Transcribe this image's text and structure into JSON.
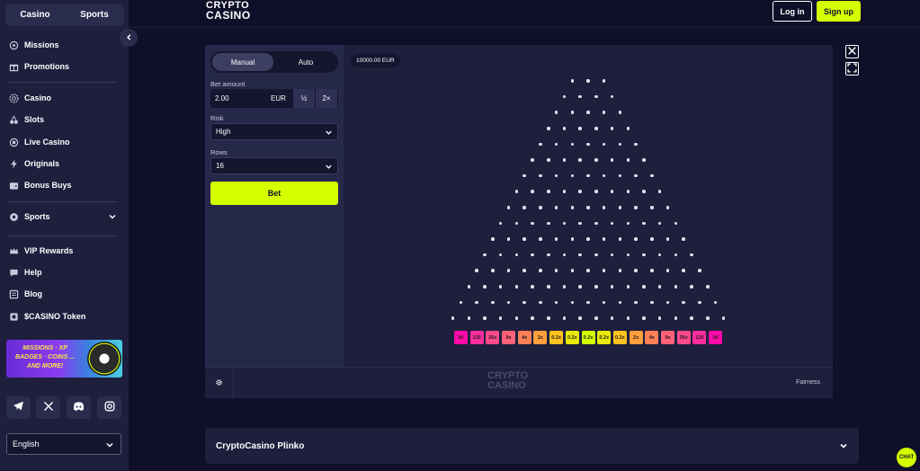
{
  "sidebar": {
    "tabs": [
      {
        "label": "Casino"
      },
      {
        "label": "Sports"
      }
    ],
    "nav": [
      {
        "label": "Missions",
        "icon": "missions-icon"
      },
      {
        "label": "Promotions",
        "icon": "gift-icon"
      },
      {
        "label": "Casino",
        "icon": "casino-chip-icon"
      },
      {
        "label": "Slots",
        "icon": "cherries-icon"
      },
      {
        "label": "Live Casino",
        "icon": "live-icon"
      },
      {
        "label": "Originals",
        "icon": "lightning-icon"
      },
      {
        "label": "Bonus Buys",
        "icon": "wallet-icon"
      },
      {
        "label": "Sports",
        "icon": "soccer-ball-icon"
      },
      {
        "label": "VIP Rewards",
        "icon": "vip-icon"
      },
      {
        "label": "Help",
        "icon": "help-icon"
      },
      {
        "label": "Blog",
        "icon": "blog-icon"
      },
      {
        "label": "$CASINO Token",
        "icon": "token-icon"
      }
    ],
    "promo": {
      "text": "MISSIONS · XP BADGES · COINS ... AND MORE!"
    },
    "socials": [
      "telegram-icon",
      "x-icon",
      "discord-icon",
      "instagram-icon"
    ],
    "language": "English"
  },
  "header": {
    "logo_line1": "CRYPTO",
    "logo_line2": "CASINO",
    "login": "Log in",
    "signup": "Sign up"
  },
  "game": {
    "modes": [
      "Manual",
      "Auto"
    ],
    "active_mode": "Manual",
    "bet_amount_label": "Bet amount",
    "bet_amount": "2.00",
    "currency": "EUR",
    "half": "½",
    "double": "2×",
    "risk_label": "Risk",
    "risk": "High",
    "rows_label": "Rows",
    "rows": "16",
    "bet_button": "Bet",
    "balance": "10000.00 EUR",
    "fairness": "Fairness",
    "watermark_line1": "CRYPTO",
    "watermark_line2": "CASINO",
    "multipliers": [
      "1K",
      "130",
      "26x",
      "9x",
      "4x",
      "2x",
      "0.2x",
      "0.2x",
      "0.2x",
      "0.2x",
      "0.2x",
      "2x",
      "4x",
      "9x",
      "26x",
      "130",
      "1K"
    ],
    "multiplier_colors": [
      "#ff0aa8",
      "#ff2e9e",
      "#ff4a8a",
      "#ff6279",
      "#ff8058",
      "#ff9e3c",
      "#ffc21e",
      "#e8e80a",
      "#d4ff00",
      "#e8e80a",
      "#ffc21e",
      "#ff9e3c",
      "#ff8058",
      "#ff6279",
      "#ff4a8a",
      "#ff2e9e",
      "#ff0aa8"
    ]
  },
  "accordion": {
    "title": "CryptoCasino Plinko"
  },
  "chat": {
    "label": "CHAT"
  },
  "colors": {
    "accent": "#d4ff00",
    "background": "#0f0f29",
    "panel": "#1d1f3d"
  }
}
